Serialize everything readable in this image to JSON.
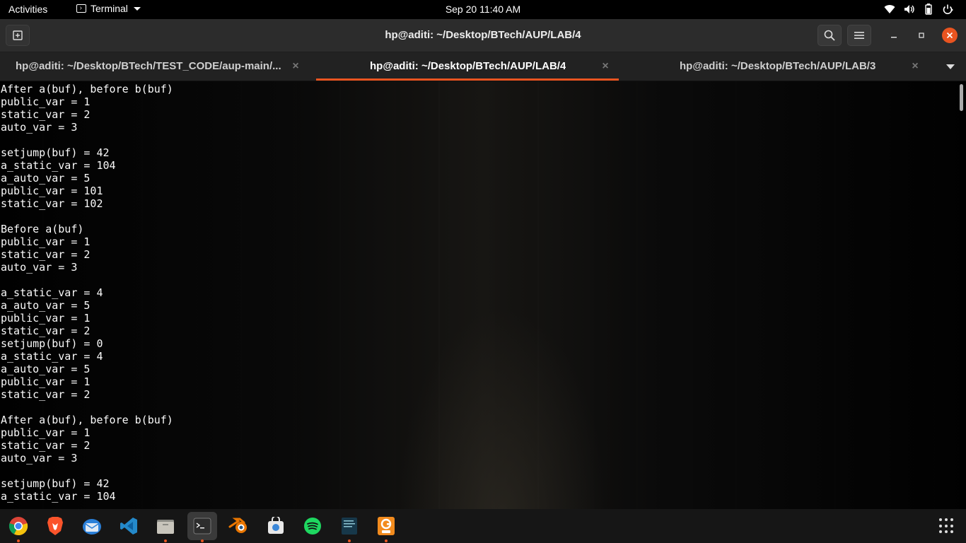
{
  "topbar": {
    "activities": "Activities",
    "app_name": "Terminal",
    "clock": "Sep 20  11:40 AM",
    "status_icons": [
      "wifi-icon",
      "volume-icon",
      "battery-icon",
      "power-icon"
    ]
  },
  "window": {
    "title": "hp@aditi: ~/Desktop/BTech/AUP/LAB/4",
    "buttons": [
      "search-icon",
      "menu-icon",
      "minimize-icon",
      "maximize-icon",
      "close-icon"
    ]
  },
  "tabs": [
    {
      "label": "hp@aditi: ~/Desktop/BTech/TEST_CODE/aup-main/...",
      "active": false
    },
    {
      "label": "hp@aditi: ~/Desktop/BTech/AUP/LAB/4",
      "active": true
    },
    {
      "label": "hp@aditi: ~/Desktop/BTech/AUP/LAB/3",
      "active": false
    }
  ],
  "terminal": {
    "output": "After a(buf), before b(buf)\npublic_var = 1\nstatic_var = 2\nauto_var = 3\n\nsetjump(buf) = 42\na_static_var = 104\na_auto_var = 5\npublic_var = 101\nstatic_var = 102\n\nBefore a(buf)\npublic_var = 1\nstatic_var = 2\nauto_var = 3\n\na_static_var = 4\na_auto_var = 5\npublic_var = 1\nstatic_var = 2\nsetjump(buf) = 0\na_static_var = 4\na_auto_var = 5\npublic_var = 1\nstatic_var = 2\n\nAfter a(buf), before b(buf)\npublic_var = 1\nstatic_var = 2\nauto_var = 3\n\nsetjump(buf) = 42\na_static_var = 104"
  },
  "dock": {
    "apps": [
      {
        "name": "chrome",
        "running": true
      },
      {
        "name": "brave",
        "running": false
      },
      {
        "name": "thunderbird",
        "running": false
      },
      {
        "name": "vscode",
        "running": false
      },
      {
        "name": "files",
        "running": true
      },
      {
        "name": "terminal",
        "running": true
      },
      {
        "name": "blender",
        "running": false
      },
      {
        "name": "software",
        "running": false
      },
      {
        "name": "spotify",
        "running": false
      },
      {
        "name": "notes",
        "running": true
      },
      {
        "name": "pdf-editor",
        "running": true
      }
    ],
    "show_apps": "show-applications-icon"
  },
  "colors": {
    "accent": "#e95420",
    "topbar": "#000000",
    "header": "#2c2c2c"
  }
}
